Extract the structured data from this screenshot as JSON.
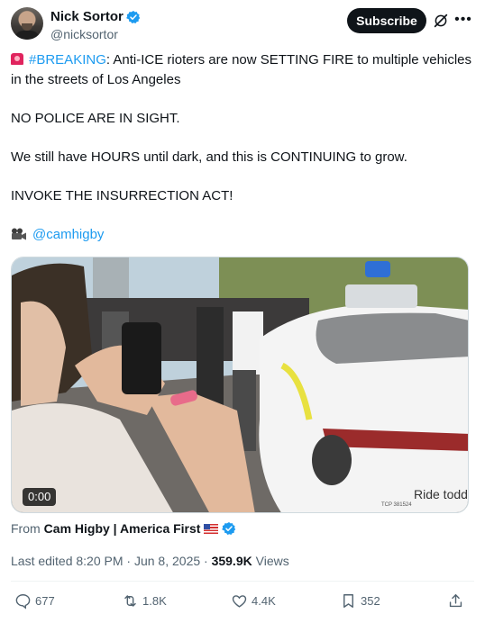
{
  "author": {
    "display_name": "Nick Sortor",
    "handle": "@nicksortor"
  },
  "header": {
    "subscribe_label": "Subscribe"
  },
  "tweet": {
    "hashtag": "#BREAKING",
    "line1_rest": ": Anti-ICE rioters are now SETTING FIRE to multiple vehicles in the streets of Los Angeles",
    "line2": "NO POLICE ARE IN SIGHT.",
    "line3": "We still have HOURS until dark, and this is CONTINUING to grow.",
    "line4": "INVOKE THE INSURRECTION ACT!",
    "mention": "@camhigby"
  },
  "media": {
    "duration": "0:00",
    "car_text_brand": "Ride todd",
    "car_plate": "TCP 381524"
  },
  "source": {
    "prefix": "From",
    "name": "Cam Higby | America First"
  },
  "meta": {
    "edited": "Last edited 8:20 PM · Jun 8, 2025 · ",
    "views_count": "359.9K",
    "views_label": " Views"
  },
  "actions": {
    "replies": "677",
    "reposts": "1.8K",
    "likes": "4.4K",
    "bookmarks": "352"
  },
  "colors": {
    "accent": "#1d9bf0",
    "text": "#0f1419",
    "muted": "#536471"
  }
}
